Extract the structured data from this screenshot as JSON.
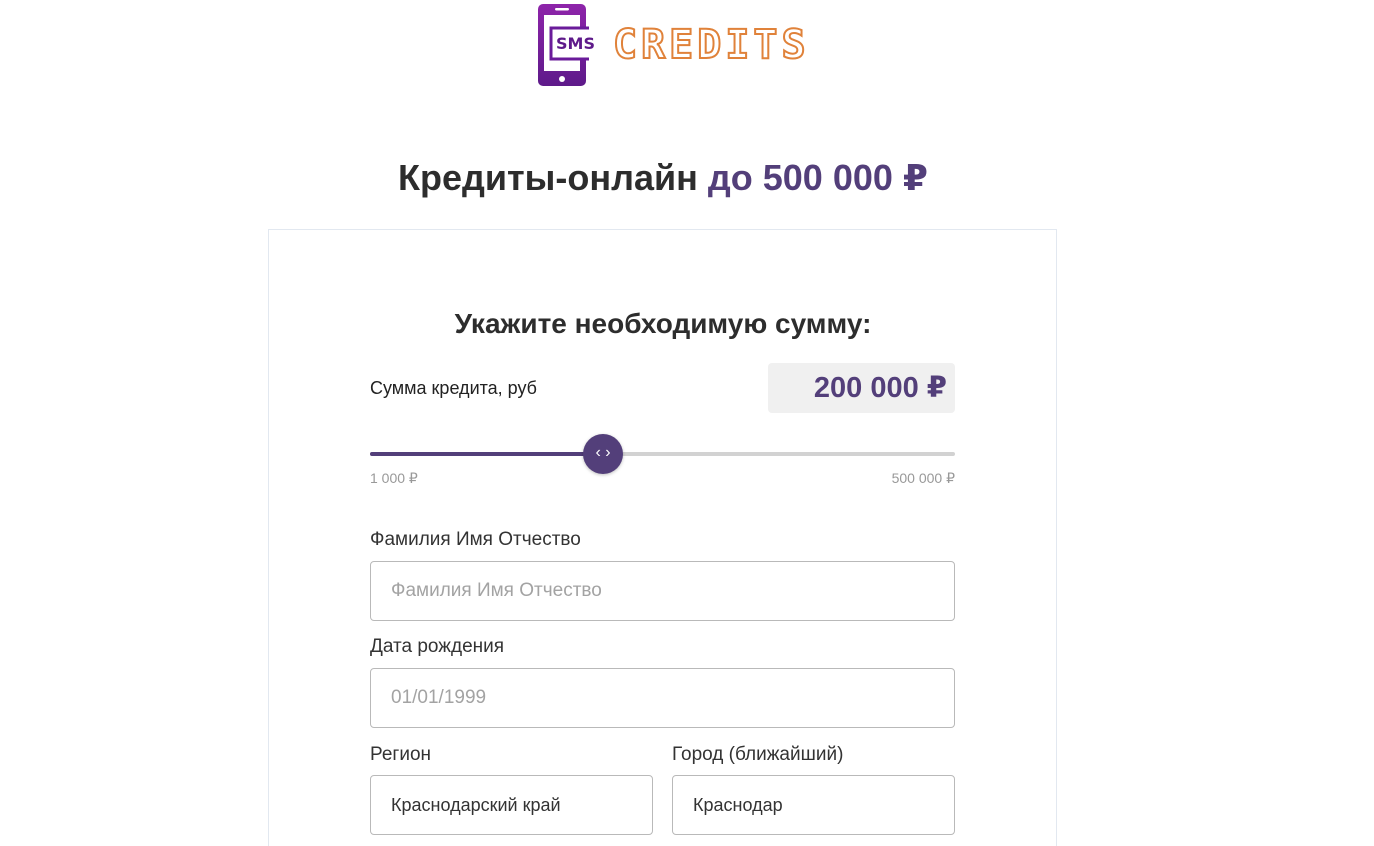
{
  "logo": {
    "badge_text": "SMS",
    "wordmark": "CREDITS"
  },
  "hero": {
    "title_prefix": "Кредиты-онлайн",
    "title_accent": "до 500 000 ₽"
  },
  "calculator": {
    "title": "Укажите необходимую сумму:",
    "amount_label": "Сумма кредита, руб",
    "amount_value": "200 000 ₽",
    "slider": {
      "min_label": "1 000 ₽",
      "max_label": "500 000 ₽",
      "min": 1000,
      "max": 500000,
      "value": 200000,
      "thumb_glyph": "‹ ›"
    }
  },
  "form": {
    "fio": {
      "label": "Фамилия Имя Отчество",
      "placeholder": "Фамилия Имя Отчество"
    },
    "birthdate": {
      "label": "Дата рождения",
      "placeholder": "01/01/1999"
    },
    "region": {
      "label": "Регион",
      "value": "Краснодарский край"
    },
    "city": {
      "label": "Город (ближайший)",
      "value": "Краснодар"
    }
  },
  "colors": {
    "accent": "#533f7a",
    "logo_orange": "#e0823a",
    "logo_purple": "#7b1fa2"
  }
}
